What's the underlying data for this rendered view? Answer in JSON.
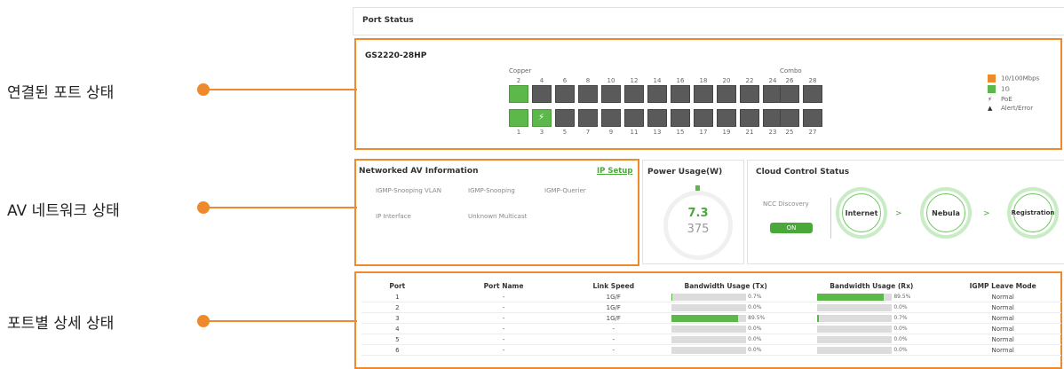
{
  "callouts": [
    {
      "label": "연결된 포트 상태"
    },
    {
      "label": "AV 네트워크 상태"
    },
    {
      "label": "포트별 상세 상태"
    }
  ],
  "header": {
    "title": "Port Status"
  },
  "device": {
    "model": "GS2220-28HP",
    "copper_label": "Copper",
    "combo_label": "Combo",
    "top_ports": [
      "2",
      "4",
      "6",
      "8",
      "10",
      "12",
      "14",
      "16",
      "18",
      "20",
      "22",
      "24"
    ],
    "bottom_ports": [
      "1",
      "3",
      "5",
      "7",
      "9",
      "11",
      "13",
      "15",
      "17",
      "19",
      "21",
      "23"
    ],
    "combo_top": [
      "26",
      "28"
    ],
    "combo_bottom": [
      "25",
      "27"
    ],
    "poe_symbol": "⚡"
  },
  "legend": [
    {
      "label": "10/100Mbps",
      "color": "#ee8a2c"
    },
    {
      "label": "1G",
      "color": "#5cb84a"
    },
    {
      "label": "PoE",
      "icon": "⚡"
    },
    {
      "label": "Alert/Error",
      "icon": "▲"
    }
  ],
  "av": {
    "title": "Networked AV Information",
    "ip_setup": "IP Setup",
    "items": [
      "IGMP-Snooping VLAN",
      "IGMP-Snooping",
      "IGMP-Querier",
      "IP Interface",
      "Unknown Multicast"
    ]
  },
  "power": {
    "title": "Power Usage(W)",
    "value": "7.3",
    "max": "375"
  },
  "cloud": {
    "title": "Cloud Control Status",
    "ncc_label": "NCC Discovery",
    "ncc_state": "ON",
    "steps": [
      "Internet",
      "Nebula",
      "Registration"
    ],
    "arrow": ">"
  },
  "table": {
    "headers": [
      "Port",
      "Port Name",
      "Link Speed",
      "Bandwidth Usage (Tx)",
      "Bandwidth Usage (Rx)",
      "IGMP Leave Mode"
    ],
    "rows": [
      {
        "port": "1",
        "name": "-",
        "speed": "1G/F",
        "tx": "0.7%",
        "tx_frac": 0.007,
        "rx": "89.5%",
        "rx_frac": 0.895,
        "mode": "Normal"
      },
      {
        "port": "2",
        "name": "-",
        "speed": "1G/F",
        "tx": "0.0%",
        "tx_frac": 0,
        "rx": "0.0%",
        "rx_frac": 0,
        "mode": "Normal"
      },
      {
        "port": "3",
        "name": "-",
        "speed": "1G/F",
        "tx": "89.5%",
        "tx_frac": 0.895,
        "rx": "0.7%",
        "rx_frac": 0.007,
        "mode": "Normal"
      },
      {
        "port": "4",
        "name": "-",
        "speed": "-",
        "tx": "0.0%",
        "tx_frac": 0,
        "rx": "0.0%",
        "rx_frac": 0,
        "mode": "Normal"
      },
      {
        "port": "5",
        "name": "-",
        "speed": "-",
        "tx": "0.0%",
        "tx_frac": 0,
        "rx": "0.0%",
        "rx_frac": 0,
        "mode": "Normal"
      },
      {
        "port": "6",
        "name": "-",
        "speed": "-",
        "tx": "0.0%",
        "tx_frac": 0,
        "rx": "0.0%",
        "rx_frac": 0,
        "mode": "Normal"
      }
    ]
  },
  "colors": {
    "accent": "#ee8a2c",
    "green": "#5cb84a",
    "port_dark": "#5a5a5a"
  }
}
